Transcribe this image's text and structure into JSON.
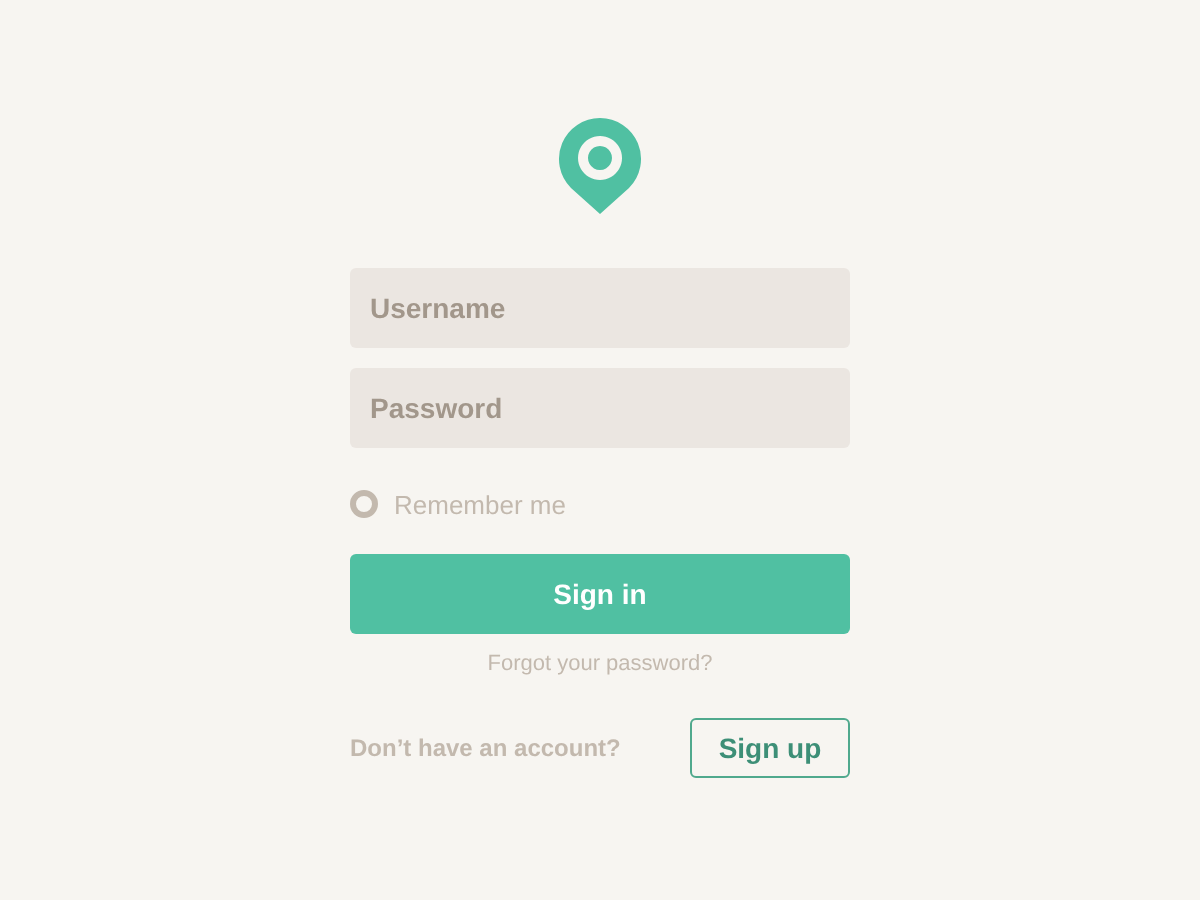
{
  "username": {
    "placeholder": "Username"
  },
  "password": {
    "placeholder": "Password"
  },
  "remember": {
    "label": "Remember me",
    "checked": false
  },
  "sign_in": {
    "label": "Sign in"
  },
  "forgot": {
    "label": "Forgot your password?"
  },
  "signup_prompt": "Don’t have an account?",
  "sign_up": {
    "label": "Sign up"
  }
}
